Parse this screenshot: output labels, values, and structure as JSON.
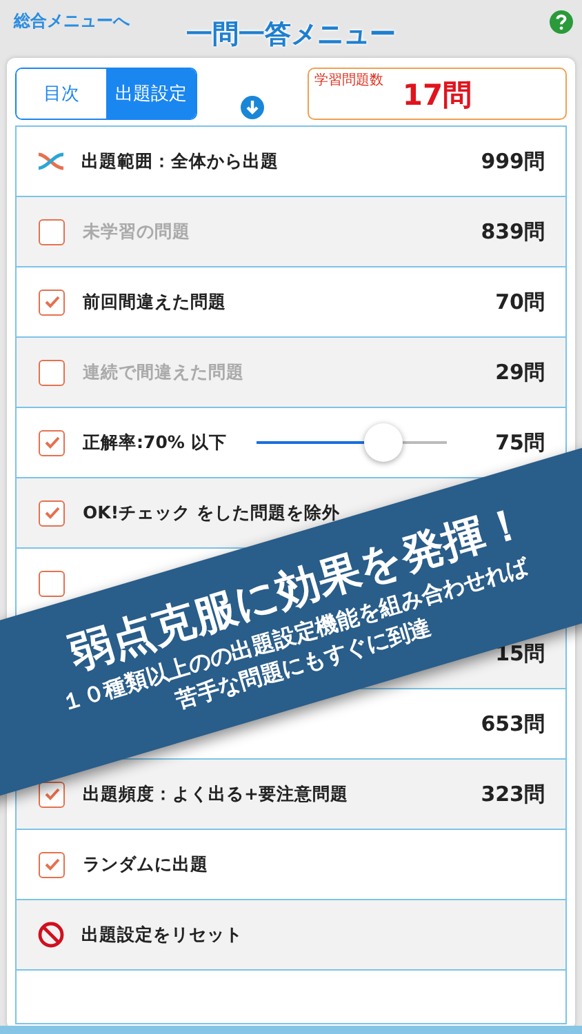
{
  "header": {
    "back_link": "総合メニューへ",
    "title": "一問一答メニュー"
  },
  "tabs": [
    {
      "label": "目次",
      "selected": false
    },
    {
      "label": "出題設定",
      "selected": true
    }
  ],
  "count_box": {
    "label": "学習問題数",
    "value": "17問"
  },
  "rows": [
    {
      "kind": "range",
      "label": "出題範囲：全体から出題",
      "count": "999問"
    },
    {
      "kind": "check",
      "checked": false,
      "label": "未学習の問題",
      "count": "839問"
    },
    {
      "kind": "check",
      "checked": true,
      "label": "前回間違えた問題",
      "count": "70問"
    },
    {
      "kind": "check",
      "checked": false,
      "label": "連続で間違えた問題",
      "count": "29問"
    },
    {
      "kind": "slider",
      "checked": true,
      "label": "正解率:70% 以下",
      "level": 0.56,
      "count": "75問"
    },
    {
      "kind": "check",
      "checked": true,
      "label": "OK!チェック をした問題を除外"
    },
    {
      "kind": "check",
      "checked": false
    },
    {
      "kind": "check",
      "count": "15問"
    },
    {
      "kind": "check",
      "count": "653問"
    },
    {
      "kind": "check",
      "checked": true,
      "label": "出題頻度：よく出る+要注意問題",
      "count": "323問"
    },
    {
      "kind": "check",
      "checked": true,
      "label": "ランダムに出題"
    },
    {
      "kind": "reset",
      "label": "出題設定をリセット"
    },
    {
      "kind": "empty"
    }
  ],
  "banner": {
    "headline": "弱点克服に効果を発揮！",
    "lines": [
      "１０種類以上のの出題設定機能を組み合わせれば",
      "苦手な問題にもすぐに到達"
    ]
  }
}
